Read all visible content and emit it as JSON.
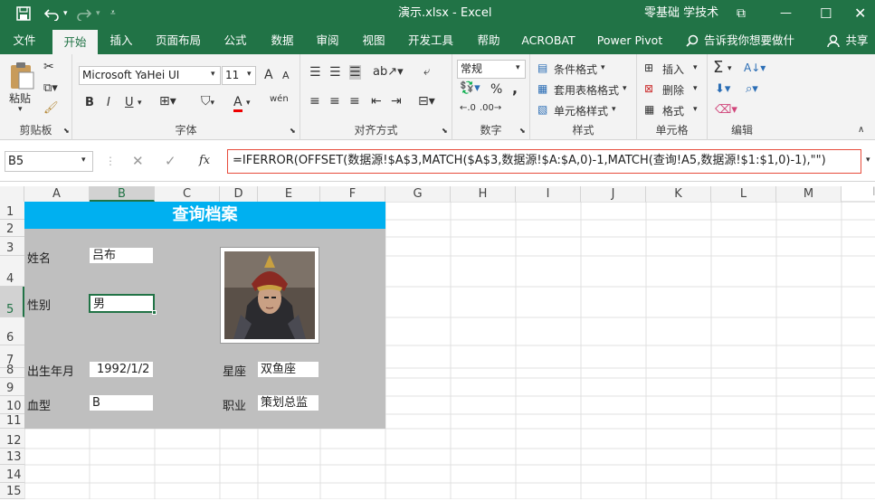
{
  "title": {
    "filename": "演示.xlsx",
    "app": "Excel",
    "brand": "零基础 学技术",
    "restore_icon": "ribbon-display-icon"
  },
  "qat": {
    "save": "save-icon",
    "undo": "undo-icon",
    "redo": "redo-icon",
    "customize": "customize-icon"
  },
  "tabs": [
    "文件",
    "开始",
    "插入",
    "页面布局",
    "公式",
    "数据",
    "审阅",
    "视图",
    "开发工具",
    "帮助",
    "ACROBAT",
    "Power Pivot"
  ],
  "tell_me": "告诉我你想要做什么",
  "share": "共享",
  "ribbon": {
    "clipboard": {
      "label": "剪贴板",
      "paste": "粘贴"
    },
    "font": {
      "label": "字体",
      "family": "Microsoft YaHei UI",
      "size": "11",
      "bold": "B",
      "italic": "I",
      "underline": "U",
      "grow": "A",
      "shrink": "A",
      "color": "A",
      "wen": "wén"
    },
    "align": {
      "label": "对齐方式"
    },
    "number": {
      "label": "数字",
      "format": "常规",
      "percent": "%",
      "comma": ","
    },
    "styles": {
      "label": "样式",
      "cond": "条件格式",
      "table": "套用表格格式",
      "cell": "单元格样式"
    },
    "cells": {
      "label": "单元格",
      "insert": "插入",
      "delete": "删除",
      "format": "格式"
    },
    "edit": {
      "label": "编辑",
      "sum": "Σ"
    }
  },
  "namebox": "B5",
  "formula": "=IFERROR(OFFSET(数据源!$A$3,MATCH($A$3,数据源!$A:$A,0)-1,MATCH(查询!A5,数据源!$1:$1,0)-1),\"\")",
  "fx": "fx",
  "columns": [
    "A",
    "B",
    "C",
    "D",
    "E",
    "F",
    "G",
    "H",
    "I",
    "J",
    "K",
    "L",
    "M"
  ],
  "rows": [
    "1",
    "2",
    "3",
    "4",
    "5",
    "6",
    "7",
    "8",
    "9",
    "10",
    "11",
    "12",
    "13",
    "14",
    "15"
  ],
  "sheet": {
    "header": "查询档案",
    "name_label": "姓名",
    "name_value": "吕布",
    "gender_label": "性别",
    "gender_value": "男",
    "birth_label": "出生年月",
    "birth_value": "1992/1/2",
    "star_label": "星座",
    "star_value": "双鱼座",
    "blood_label": "血型",
    "blood_value": "B",
    "job_label": "职业",
    "job_value": "策划总监"
  },
  "colors": {
    "accent": "#217346",
    "header_fill": "#00b0f0",
    "panel_fill": "#bfbfbf",
    "formula_border": "#e74c3c"
  }
}
